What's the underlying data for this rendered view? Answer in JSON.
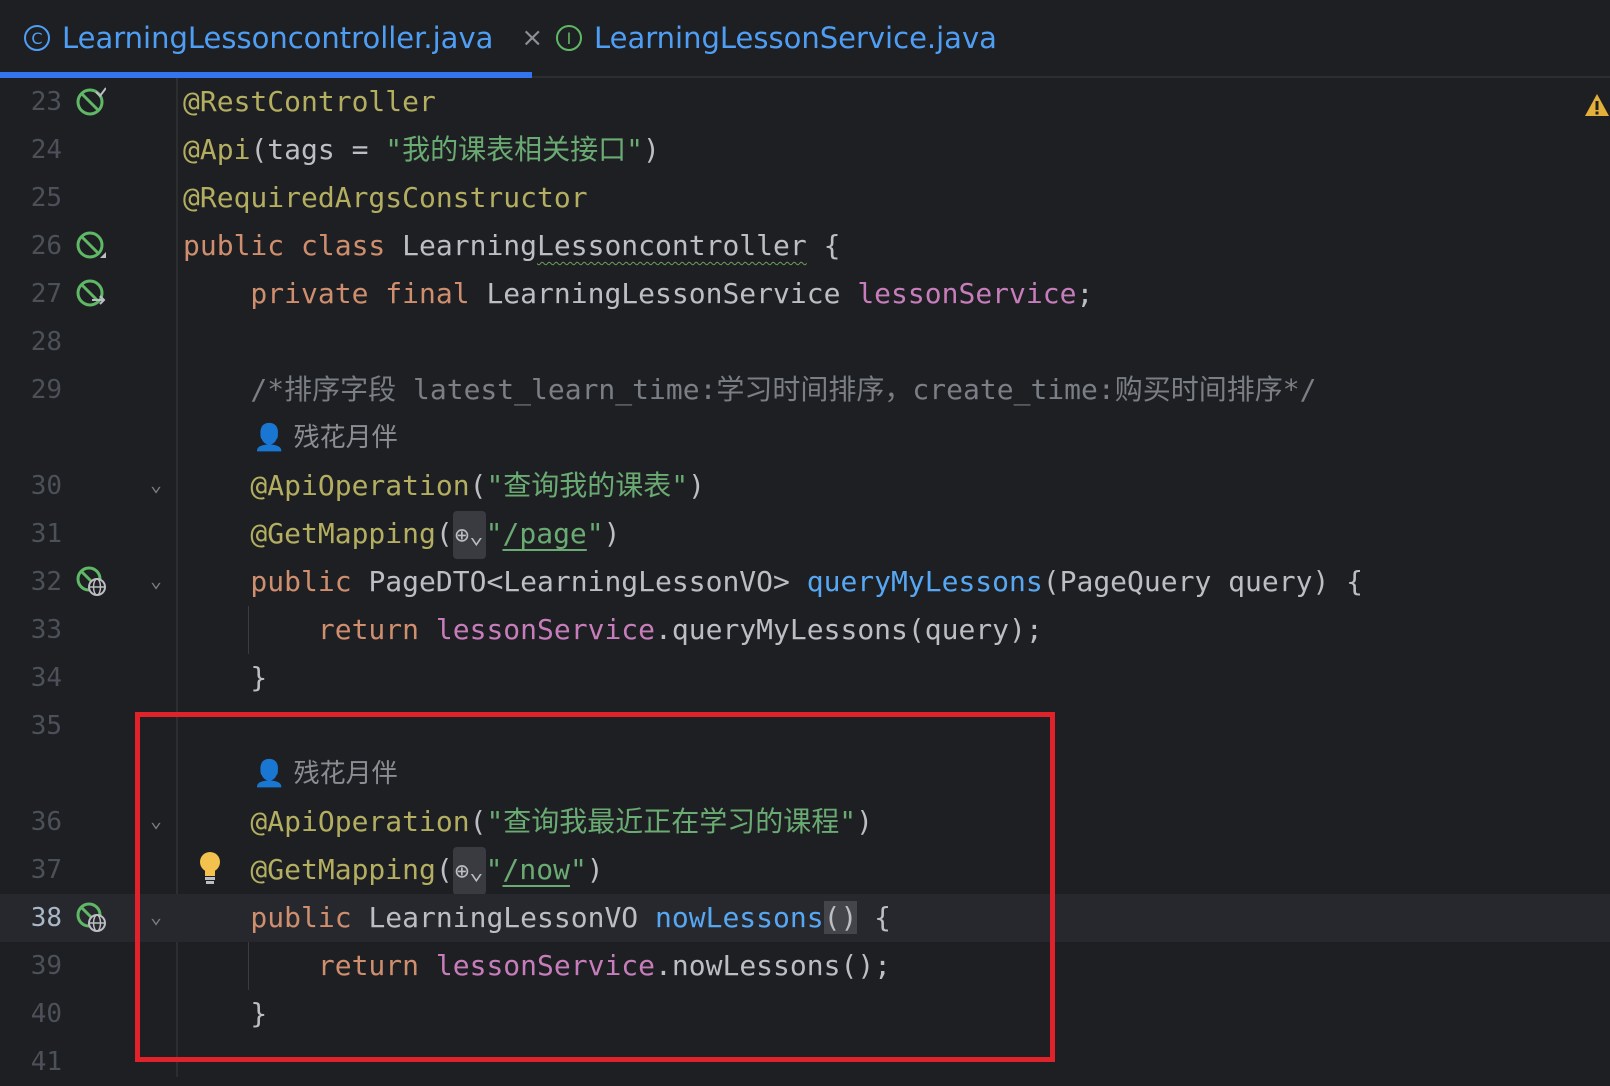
{
  "tabs": [
    {
      "label": "LearningLessoncontroller.java",
      "icon": "class-icon",
      "active": true
    },
    {
      "label": "LearningLessonService.java",
      "icon": "interface-icon",
      "active": false
    }
  ],
  "tab_close_glyph": "×",
  "lines": [
    {
      "n": "23"
    },
    {
      "n": "24"
    },
    {
      "n": "25"
    },
    {
      "n": "26"
    },
    {
      "n": "27"
    },
    {
      "n": "28"
    },
    {
      "n": "29"
    },
    {
      "n": ""
    },
    {
      "n": "30"
    },
    {
      "n": "31"
    },
    {
      "n": "32"
    },
    {
      "n": "33"
    },
    {
      "n": "34"
    },
    {
      "n": "35"
    },
    {
      "n": ""
    },
    {
      "n": "36"
    },
    {
      "n": "37"
    },
    {
      "n": "38"
    },
    {
      "n": "39"
    },
    {
      "n": "40"
    },
    {
      "n": "41"
    }
  ],
  "code": {
    "l23": "@RestController",
    "l24_a": "@Api",
    "l24_b": "(tags = ",
    "l24_c": "\"我的课表相关接口\"",
    "l24_d": ")",
    "l25": "@RequiredArgsConstructor",
    "l26_kw": "public class ",
    "l26_name_a": "Learning",
    "l26_name_b": "Lessoncontroller",
    "l26_end": " {",
    "l27_kw": "    private final ",
    "l27_type": "LearningLessonService ",
    "l27_field": "lessonService",
    "l27_end": ";",
    "l29": "    /*排序字段 latest_learn_time:学习时间排序，create_time:购买时间排序*/",
    "author": "残花月伴",
    "l30_a": "    @ApiOperation",
    "l30_b": "(",
    "l30_c": "\"查询我的课表\"",
    "l30_d": ")",
    "l31_a": "    @GetMapping",
    "l31_b": "(",
    "l31_q1": "\"",
    "l31_path": "/page",
    "l31_q2": "\"",
    "l31_d": ")",
    "l32_kw": "    public ",
    "l32_type": "PageDTO<LearningLessonVO> ",
    "l32_fn": "queryMyLessons",
    "l32_rest": "(PageQuery query) {",
    "l33_kw": "        return ",
    "l33_field": "lessonService",
    "l33_rest": ".queryMyLessons(query);",
    "l34": "    }",
    "l36_a": "    @ApiOperation",
    "l36_b": "(",
    "l36_c": "\"查询我最近正在学习的课程\"",
    "l36_d": ")",
    "l37_a": "    @GetMapping",
    "l37_b": "(",
    "l37_q1": "\"",
    "l37_path": "/now",
    "l37_q2": "\"",
    "l37_d": ")",
    "l38_kw": "    public ",
    "l38_type": "LearningLessonVO ",
    "l38_fn": "nowLessons",
    "l38_paren": "()",
    "l38_end": " {",
    "l39_kw": "        return ",
    "l39_field": "lessonService",
    "l39_rest": ".nowLessons();",
    "l40": "    }"
  },
  "colors": {
    "background": "#1e1f22",
    "annotation": "#b3ae60",
    "keyword": "#cf8e6d",
    "string": "#6aab73",
    "field": "#c77dbb",
    "method": "#56a8f5",
    "highlight_box": "#e0232b",
    "tab_text": "#4f9ef5"
  }
}
